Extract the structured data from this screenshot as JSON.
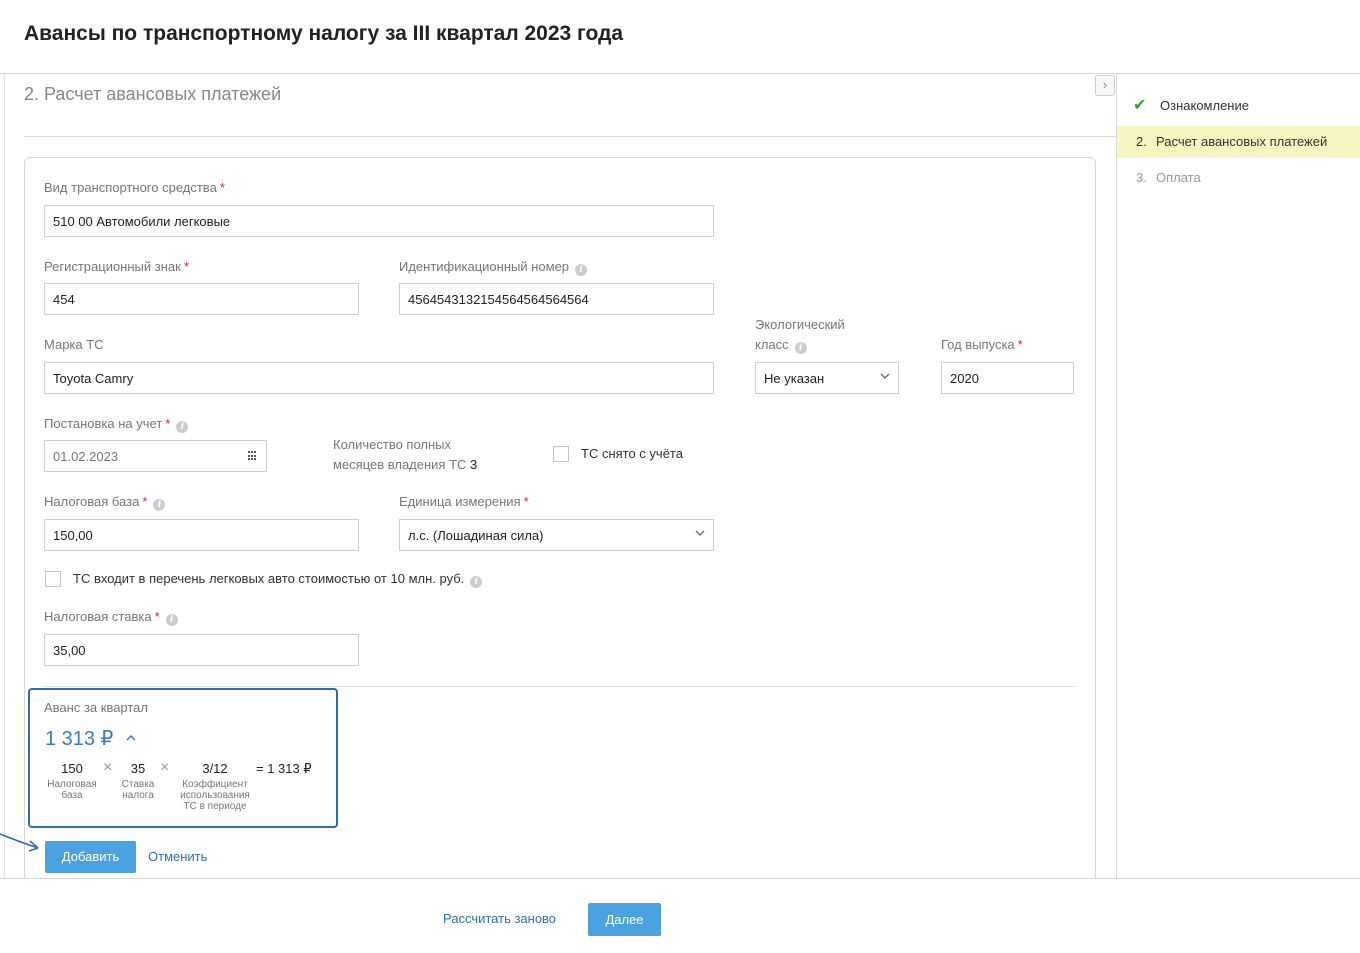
{
  "header": {
    "title": "Авансы по транспортному налогу за III квартал 2023 года"
  },
  "section": {
    "title": "2. Расчет авансовых платежей",
    "collapse_icon": "chevron-right-icon"
  },
  "sidebar": {
    "steps": [
      {
        "num": "",
        "label": "Ознакомление"
      },
      {
        "num": "2.",
        "label": "Расчет авансовых платежей"
      },
      {
        "num": "3.",
        "label": "Оплата"
      }
    ]
  },
  "form": {
    "vehicle_type": {
      "label": "Вид транспортного средства",
      "required": "*",
      "value": "510 00 Автомобили легковые"
    },
    "reg_sign": {
      "label": "Регистрационный знак",
      "required": "*",
      "value": "454"
    },
    "vin": {
      "label": "Идентификационный номер",
      "value": "4564543132154564564564564"
    },
    "brand": {
      "label": "Марка ТС",
      "value": "Toyota Camry"
    },
    "eco_class": {
      "label_line1": "Экологический",
      "label_line2": "класс",
      "value": "Не указан"
    },
    "year": {
      "label": "Год выпуска",
      "required": "*",
      "value": "2020"
    },
    "registration_date": {
      "label": "Постановка на учет",
      "required": "*",
      "value": "01.02.2023"
    },
    "months": {
      "label_line1": "Количество полных",
      "label_line2": "месяцев владения ТС",
      "value": "3"
    },
    "deregistered": {
      "label": "ТС снято с учёта"
    },
    "tax_base": {
      "label": "Налоговая база",
      "required": "*",
      "value": "150,00"
    },
    "unit": {
      "label": "Единица измерения",
      "required": "*",
      "value": "л.с. (Лошадиная сила)"
    },
    "luxury": {
      "label": "ТС входит в перечень легковых авто стоимостью от 10 млн. руб."
    },
    "tax_rate": {
      "label": "Налоговая ставка",
      "required": "*",
      "value": "35,00"
    }
  },
  "advance": {
    "label": "Аванс за квартал",
    "amount": "1 313 ₽",
    "toggle_icon": "chevron-up-icon",
    "factors": [
      {
        "value": "150",
        "caption": "Налоговая база"
      },
      {
        "value": "35",
        "caption": "Ставка налога"
      },
      {
        "value": "3/12",
        "caption": "Коэффициент использования ТС в периоде"
      }
    ],
    "multiply": "×",
    "result": "= 1 313 ₽"
  },
  "actions": {
    "add": "Добавить",
    "cancel": "Отменить"
  },
  "footer": {
    "recalc": "Рассчитать заново",
    "next": "Далее"
  },
  "colors": {
    "accent": "#4aa3e0",
    "highlight": "#f6f6c2",
    "frame": "#2f6db3",
    "required": "#dd2233"
  }
}
